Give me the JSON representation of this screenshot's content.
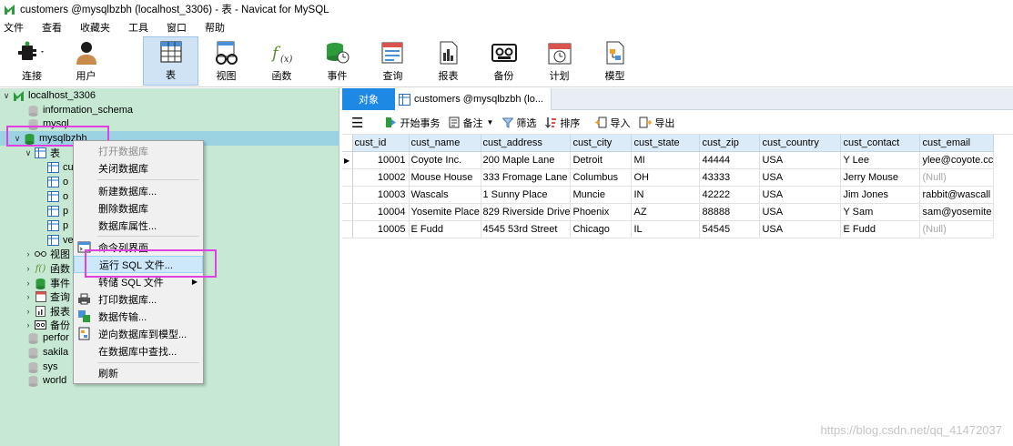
{
  "window": {
    "title": "customers @mysqlbzbh (localhost_3306) - 表 - Navicat for MySQL"
  },
  "menubar": [
    "文件",
    "查看",
    "收藏夹",
    "工具",
    "窗口",
    "帮助"
  ],
  "toolbar": {
    "connect": "连接",
    "user": "用户",
    "table": "表",
    "view": "视图",
    "function": "函数",
    "event": "事件",
    "query": "查询",
    "report": "报表",
    "backup": "备份",
    "schedule": "计划",
    "model": "模型"
  },
  "tree": {
    "connection": "localhost_3306",
    "db_information_schema": "information_schema",
    "db_mysql": "mysql",
    "db_selected": "mysqlbzbh",
    "tables_label": "表",
    "table_children": [
      "cu",
      "o",
      "o",
      "p",
      "p",
      "ve"
    ],
    "views_label": "视图",
    "functions_label": "函数",
    "events_label": "事件",
    "queries_label": "查询",
    "reports_label": "报表",
    "backups_label": "备份",
    "db_perfor": "perfor",
    "db_sakila": "sakila",
    "db_sys": "sys",
    "db_world": "world"
  },
  "context_menu": {
    "open_db": "打开数据库",
    "close_db": "关闭数据库",
    "new_db": "新建数据库...",
    "delete_db": "删除数据库",
    "db_props": "数据库属性...",
    "cmd_line": "命令列界面",
    "run_sql": "运行 SQL 文件...",
    "dump_sql": "转储 SQL 文件",
    "print_db": "打印数据库...",
    "transfer": "数据传输...",
    "reverse_model": "逆向数据库到模型...",
    "find_in_db": "在数据库中查找...",
    "refresh": "刷新"
  },
  "tabs": {
    "objects": "对象",
    "customers": "customers @mysqlbzbh (lo..."
  },
  "grid_toolbar": {
    "begin_tx": "开始事务",
    "note": "备注",
    "filter": "筛选",
    "sort": "排序",
    "import": "导入",
    "export": "导出"
  },
  "grid": {
    "columns": [
      "cust_id",
      "cust_name",
      "cust_address",
      "cust_city",
      "cust_state",
      "cust_zip",
      "cust_country",
      "cust_contact",
      "cust_email"
    ],
    "rows": [
      [
        "10001",
        "Coyote Inc.",
        "200 Maple Lane",
        "Detroit",
        "MI",
        "44444",
        "USA",
        "Y Lee",
        "ylee@coyote.cc"
      ],
      [
        "10002",
        "Mouse House",
        "333 Fromage Lane",
        "Columbus",
        "OH",
        "43333",
        "USA",
        "Jerry Mouse",
        "(Null)"
      ],
      [
        "10003",
        "Wascals",
        "1 Sunny Place",
        "Muncie",
        "IN",
        "42222",
        "USA",
        "Jim Jones",
        "rabbit@wascall"
      ],
      [
        "10004",
        "Yosemite Place",
        "829 Riverside Drive",
        "Phoenix",
        "AZ",
        "88888",
        "USA",
        "Y Sam",
        "sam@yosemite"
      ],
      [
        "10005",
        "E Fudd",
        "4545 53rd Street",
        "Chicago",
        "IL",
        "54545",
        "USA",
        "E Fudd",
        "(Null)"
      ]
    ]
  },
  "watermark": "https://blog.csdn.net/qq_41472037",
  "colors": {
    "accent": "#1e88e5",
    "tree_bg": "#c7e9d4",
    "highlight_box": "#e040e0",
    "selected_row": "#9bd3e3"
  }
}
